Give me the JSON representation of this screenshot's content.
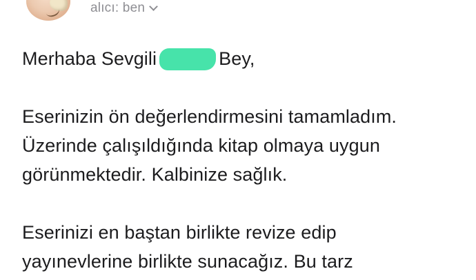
{
  "header": {
    "recipient_label": "alıcı: ben"
  },
  "message": {
    "greeting_start": "Merhaba Sevgili",
    "greeting_end": "Bey,",
    "paragraph1": [
      "Eserinizin ön değerlendirmesini tamamladım.",
      "Üzerinde çalışıldığında kitap olmaya uygun",
      "görünmektedir. Kalbinize sağlık."
    ],
    "paragraph2": [
      "Eserinizi en baştan birlikte revize edip",
      "yayınevlerine birlikte sunacağız. Bu tarz"
    ]
  },
  "colors": {
    "redaction": "#47e3aa",
    "secondary_text": "#8e8e93"
  },
  "icons": {
    "avatar": "sender-avatar",
    "chevron": "chevron-down-icon"
  }
}
